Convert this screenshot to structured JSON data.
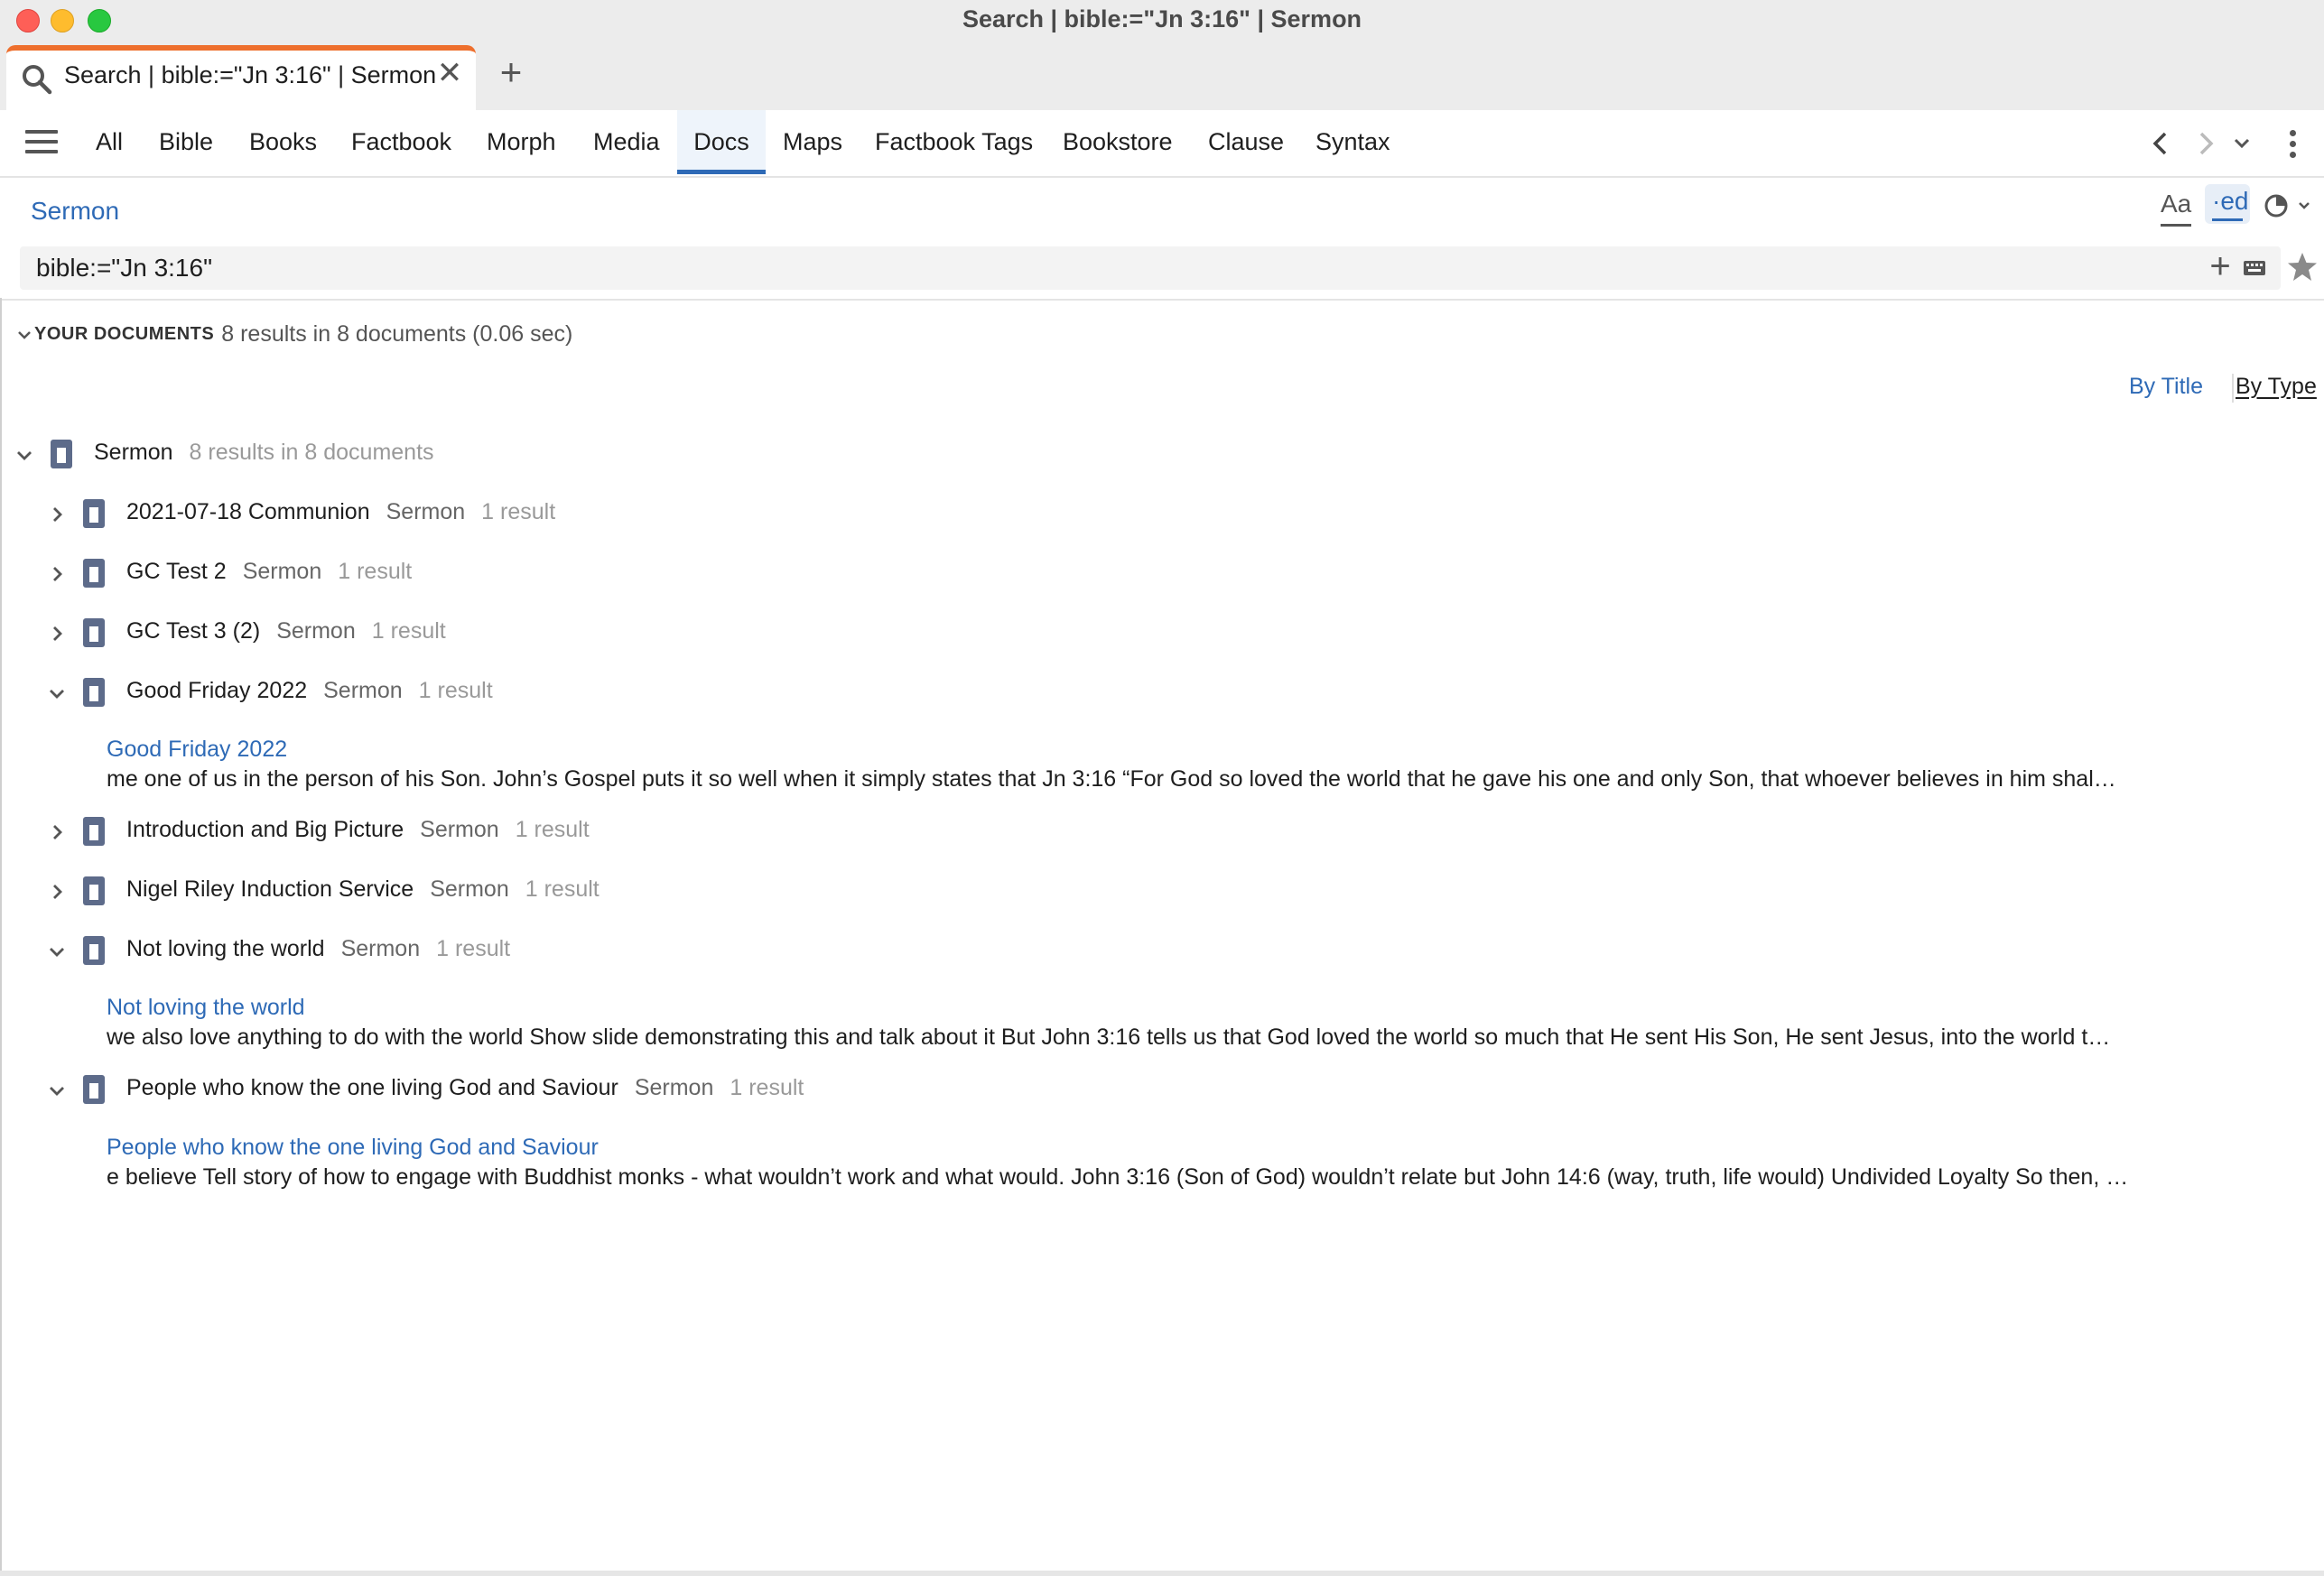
{
  "window": {
    "title": "Search | bible:=\"Jn 3:16\" | Sermon"
  },
  "tab": {
    "title": "Search | bible:=\"Jn 3:16\" | Sermon",
    "close": "✕",
    "new": "+"
  },
  "nav": {
    "tabs": [
      "All",
      "Bible",
      "Books",
      "Factbook",
      "Morph",
      "Media",
      "Docs",
      "Maps",
      "Factbook Tags",
      "Bookstore",
      "Clause",
      "Syntax"
    ],
    "active": "Docs"
  },
  "breadcrumb": "Sermon",
  "tools": {
    "font": "Aa",
    "ed": "·ed"
  },
  "search": {
    "value": "bible:=\"Jn 3:16\""
  },
  "results": {
    "section_label": "YOUR DOCUMENTS",
    "summary": "8 results in 8 documents (0.06 sec)",
    "sort_by_title": "By Title",
    "sort_by_type": "By Type",
    "group": {
      "title": "Sermon",
      "summary": "8 results in 8 documents"
    },
    "docs": [
      {
        "title": "2021-07-18 Communion",
        "type": "Sermon",
        "count": "1 result"
      },
      {
        "title": "GC Test 2",
        "type": "Sermon",
        "count": "1 result"
      },
      {
        "title": "GC Test 3 (2)",
        "type": "Sermon",
        "count": "1 result"
      },
      {
        "title": "Good Friday 2022",
        "type": "Sermon",
        "count": "1 result",
        "snippet_title": "Good Friday 2022",
        "snippet": "me one of us in the person of his Son. John’s Gospel puts it so well when it simply states that Jn 3:16 “For God so loved the world that he gave his one and only Son, that whoever believes in him shal…"
      },
      {
        "title": "Introduction and Big Picture",
        "type": "Sermon",
        "count": "1 result"
      },
      {
        "title": "Nigel Riley Induction Service",
        "type": "Sermon",
        "count": "1 result"
      },
      {
        "title": "Not loving the world",
        "type": "Sermon",
        "count": "1 result",
        "snippet_title": "Not loving the world",
        "snippet": "we also love anything to do with the world Show slide demonstrating this and talk about it But John 3:16 tells us that God loved the world so much that He sent His Son, He sent Jesus, into the world t…"
      },
      {
        "title": "People who know the one living God and Saviour",
        "type": "Sermon",
        "count": "1 result",
        "snippet_title": "People who know the one living God and Saviour",
        "snippet": "e believe Tell story of how to engage with Buddhist monks - what wouldn’t work and what would. John 3:16 (Son of God) wouldn’t relate but John 14:6 (way, truth, life would) Undivided Loyalty So then, …"
      }
    ]
  },
  "colors": {
    "accent": "#2e6ab6",
    "tab_accent": "#ee6f2d",
    "doc_icon": "#5d6b8a"
  }
}
